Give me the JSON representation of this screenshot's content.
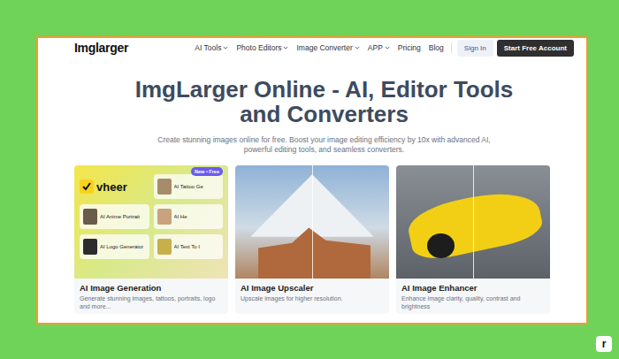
{
  "nav": {
    "logo": "Imglarger",
    "items": [
      {
        "label": "AI Tools",
        "dropdown": true
      },
      {
        "label": "Photo Editors",
        "dropdown": true
      },
      {
        "label": "Image Converter",
        "dropdown": true
      },
      {
        "label": "APP",
        "dropdown": true
      },
      {
        "label": "Pricing",
        "dropdown": false
      },
      {
        "label": "Blog",
        "dropdown": false
      }
    ],
    "sign_in": "Sign In",
    "cta": "Start Free Account"
  },
  "hero": {
    "title": "ImgLarger Online - AI, Editor Tools and Converters",
    "subtitle": "Create stunning images online for free. Boost your image editing efficiency by 10x with advanced AI, powerful editing tools, and seamless converters."
  },
  "cards": [
    {
      "kind": "promo",
      "title": "AI Image Generation",
      "description": "Generate stunning images, tattoos, portraits, logo and more..."
    },
    {
      "kind": "landscape",
      "title": "AI Image Upscaler",
      "description": "Upscale images for higher resolution."
    },
    {
      "kind": "car",
      "title": "AI Image Enhancer",
      "description": "Enhance image clarity, quality, contrast and brightness"
    }
  ],
  "promo": {
    "brand": "vheer",
    "badge": "New • Free",
    "tiles": [
      "AI Tattoo Ge",
      "AI Anime Portrait",
      "AI He",
      "AI Logo Generator",
      "AI Text To I"
    ]
  },
  "corner_logo": "r"
}
